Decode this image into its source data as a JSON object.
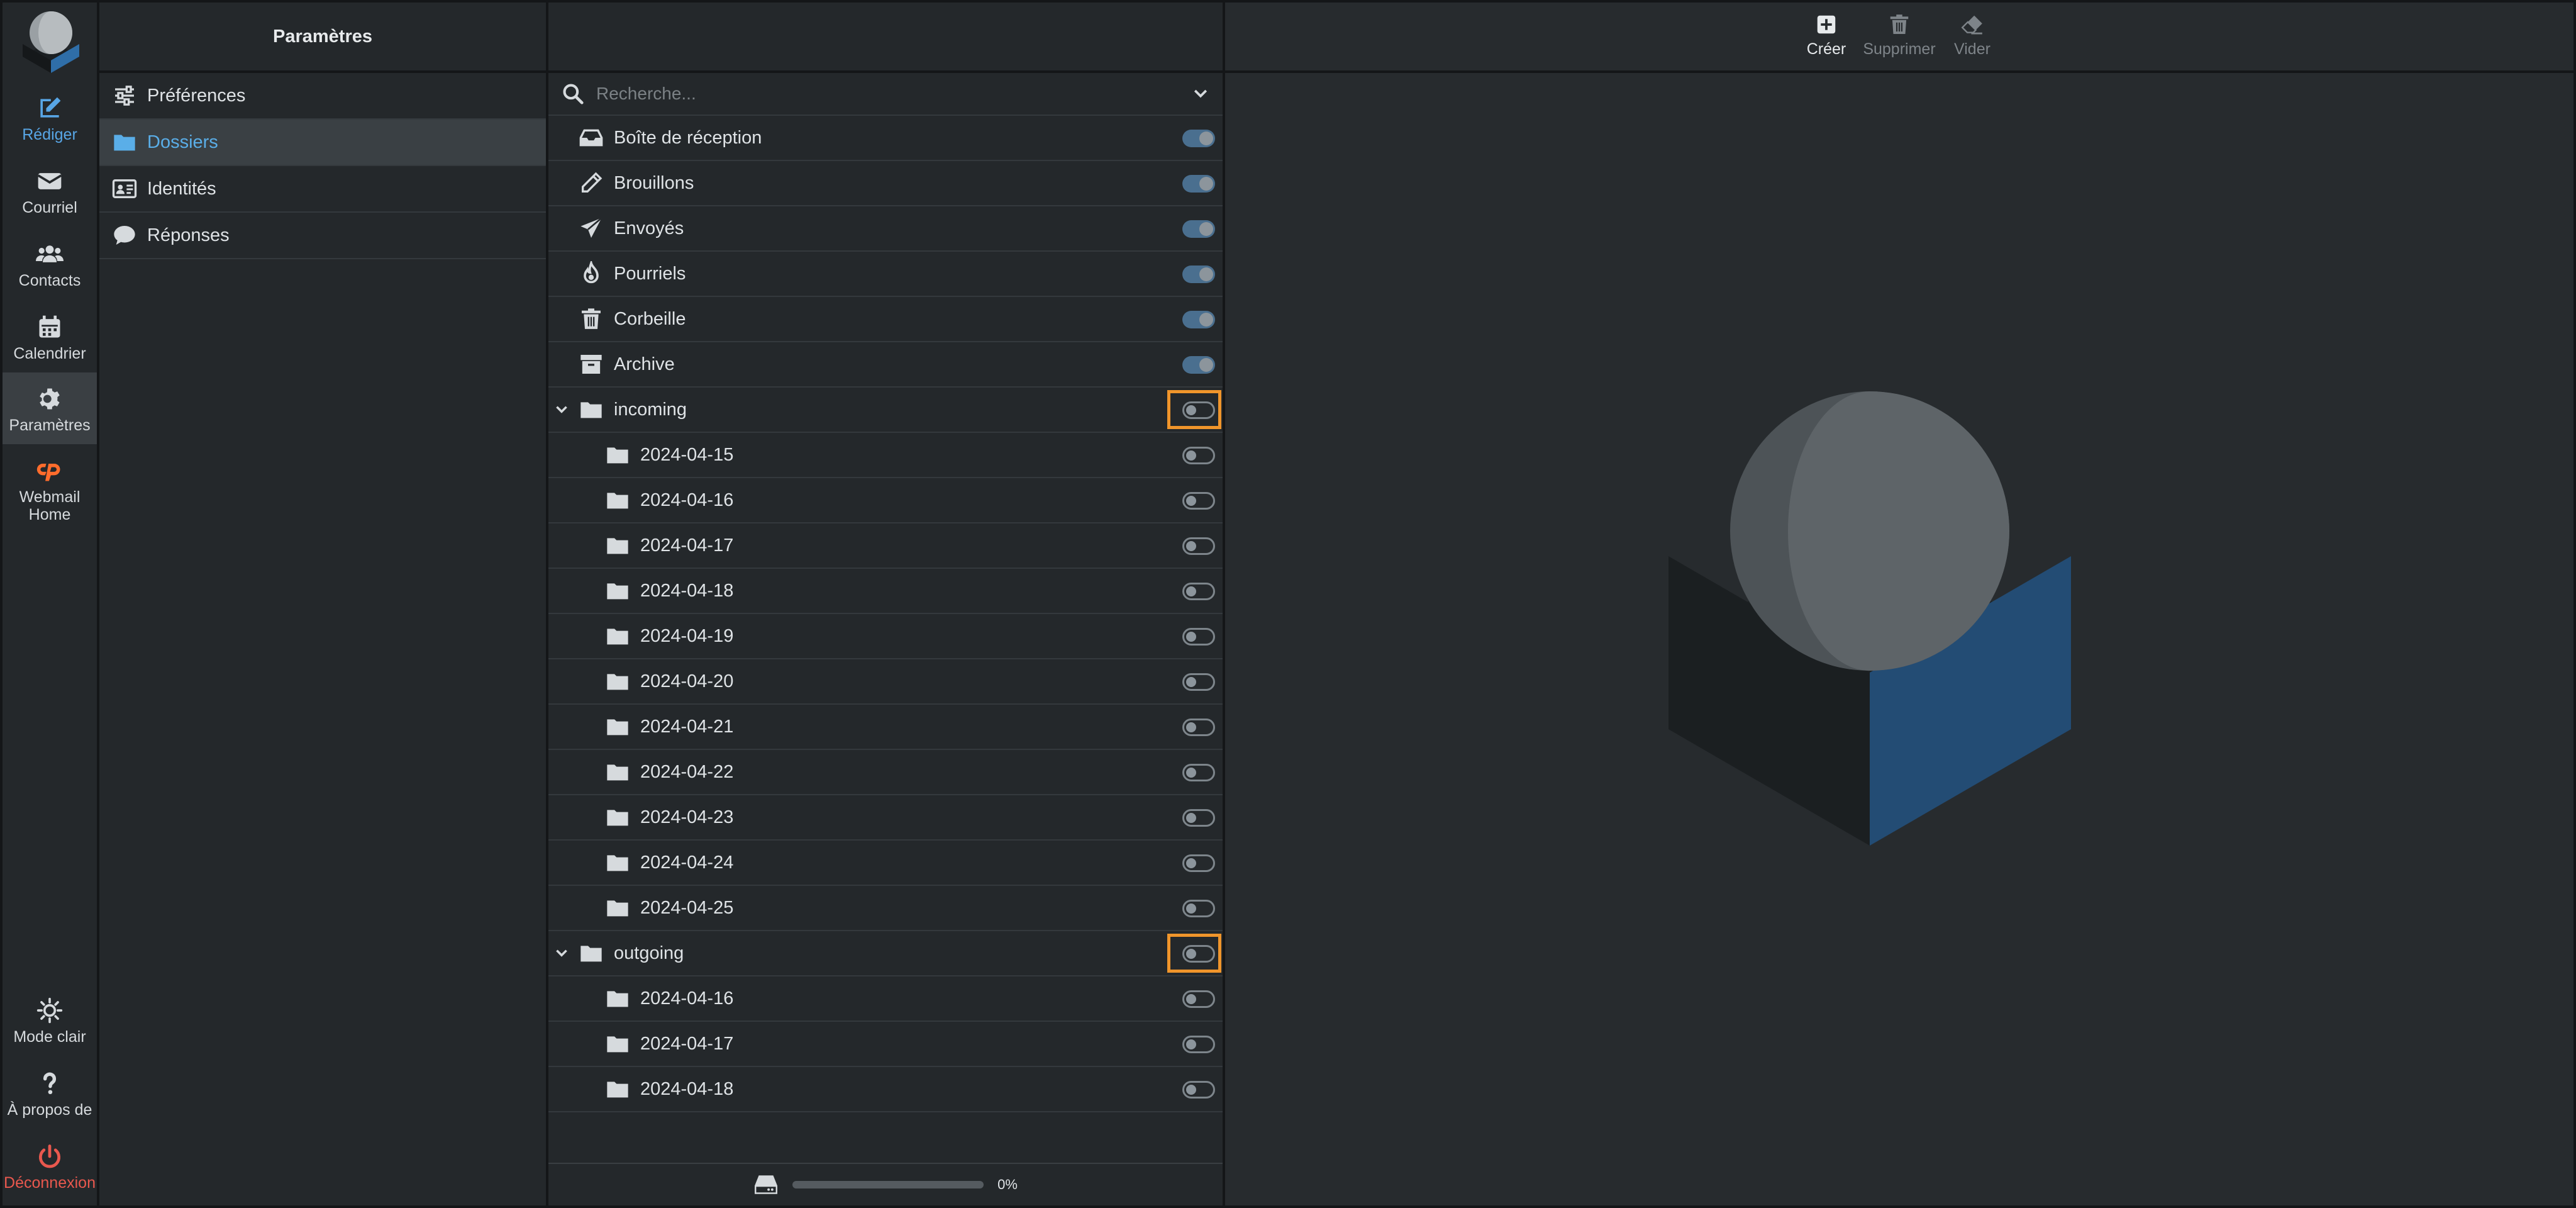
{
  "nav": {
    "items": [
      {
        "label": "Rédiger",
        "icon": "compose-icon"
      },
      {
        "label": "Courriel",
        "icon": "envelope-icon"
      },
      {
        "label": "Contacts",
        "icon": "users-icon"
      },
      {
        "label": "Calendrier",
        "icon": "calendar-icon"
      },
      {
        "label": "Paramètres",
        "icon": "gear-icon"
      },
      {
        "label": "Webmail Home",
        "icon": "cpanel-icon"
      }
    ],
    "bottom": [
      {
        "label": "Mode clair",
        "icon": "sun-icon"
      },
      {
        "label": "À propos de",
        "icon": "question-icon"
      },
      {
        "label": "Déconnexion",
        "icon": "power-icon"
      }
    ]
  },
  "settings": {
    "title": "Paramètres",
    "items": [
      {
        "label": "Préférences",
        "icon": "sliders-icon"
      },
      {
        "label": "Dossiers",
        "icon": "folder-icon"
      },
      {
        "label": "Identités",
        "icon": "id-card-icon"
      },
      {
        "label": "Réponses",
        "icon": "comment-icon"
      }
    ]
  },
  "folders": {
    "search_placeholder": "Recherche...",
    "special": [
      {
        "name": "Boîte de réception",
        "icon": "inbox-icon",
        "subscribed": true
      },
      {
        "name": "Brouillons",
        "icon": "pencil-icon",
        "subscribed": true
      },
      {
        "name": "Envoyés",
        "icon": "paper-plane-icon",
        "subscribed": true
      },
      {
        "name": "Pourriels",
        "icon": "fire-icon",
        "subscribed": true
      },
      {
        "name": "Corbeille",
        "icon": "trash-icon",
        "subscribed": true
      },
      {
        "name": "Archive",
        "icon": "archive-box-icon",
        "subscribed": true
      }
    ],
    "incoming": {
      "name": "incoming",
      "subscribed": false,
      "children": [
        "2024-04-15",
        "2024-04-16",
        "2024-04-17",
        "2024-04-18",
        "2024-04-19",
        "2024-04-20",
        "2024-04-21",
        "2024-04-22",
        "2024-04-23",
        "2024-04-24",
        "2024-04-25"
      ]
    },
    "outgoing": {
      "name": "outgoing",
      "subscribed": false,
      "children": [
        "2024-04-16",
        "2024-04-17",
        "2024-04-18"
      ]
    },
    "quota": {
      "text": "0%",
      "value": 0
    }
  },
  "toolbar": {
    "create": "Créer",
    "delete": "Supprimer",
    "empty": "Vider"
  },
  "colors": {
    "accent": "#58a6e6",
    "danger": "#e9584e",
    "highlight": "#f0952b",
    "cpanel": "#ff6c2c"
  }
}
